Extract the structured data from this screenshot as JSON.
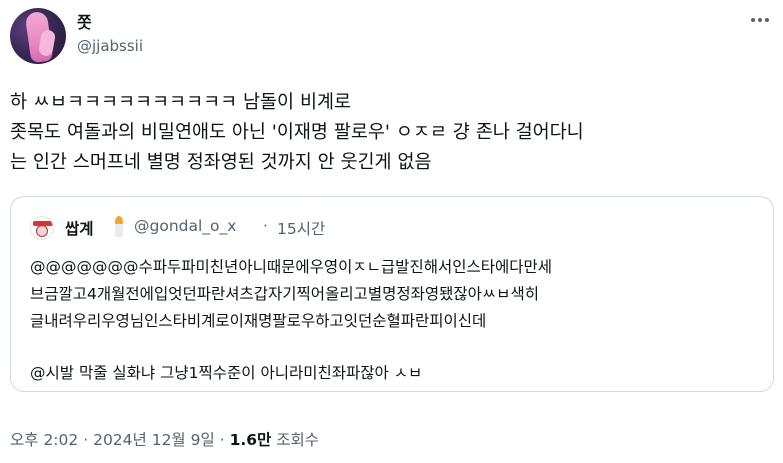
{
  "tweet": {
    "author": {
      "display_name": "쫏",
      "handle": "@jjabssii"
    },
    "text_lines": [
      "하 ㅆㅂㅋㅋㅋㅋㅋㅋㅋㅋㅋㅋ 남돌이 비계로",
      "좃목도 여돌과의 비밀연애도 아닌 '이재명 팔로우' ㅇㅈㄹ 걍 존나 걸어다니",
      "는 인간 스머프네 별명 정좌영된 것까지 안 웃긴게 없음"
    ],
    "meta": {
      "time": "오후 2:02",
      "sep1": "·",
      "date": "2024년 12월 9일",
      "sep2": "·",
      "views_count": "1.6만",
      "views_label": "조회수"
    }
  },
  "quote": {
    "display_name": "쌉계",
    "handle": "@gondal_o_x",
    "sep": "·",
    "time": "15시간",
    "text_lines": [
      "@@@@@@@수파두파미친년아니때문에우영이ㅈㄴ급발진해서인스타에다만세",
      "브금깔고4개월전에입엇던파란셔츠갑자기찍어올리고별명정좌영됐잖아ㅆㅂ색히",
      "글내려우리우영님인스타비계로이재명팔로우하고잇던순혈파란피이신데"
    ],
    "text_line_last": "@시발 막줄 실화냐 그냥1찍수준이 아니라미친좌파잖아 ㅅㅂ"
  },
  "icons": {
    "more": "more-horizontal-icon",
    "candle": "candle-emoji-icon"
  }
}
